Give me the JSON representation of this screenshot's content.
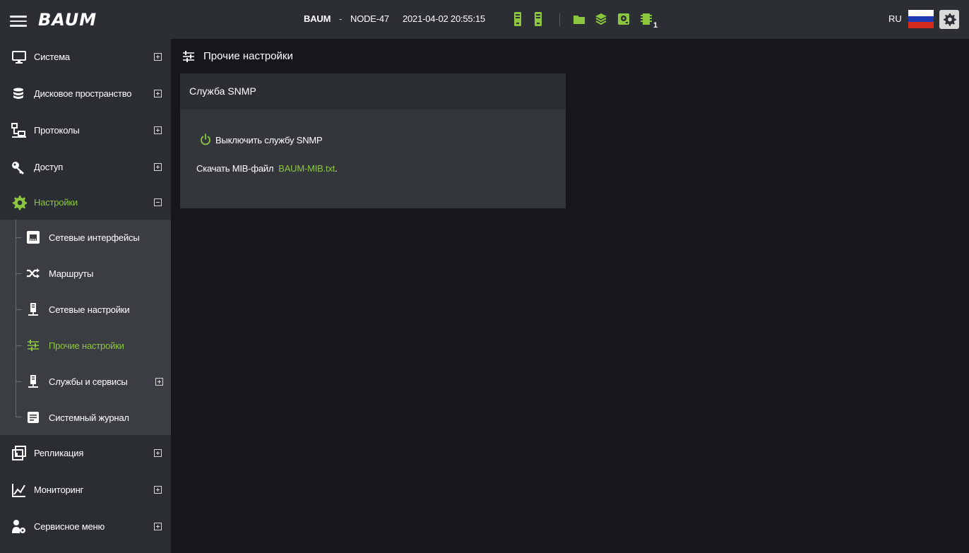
{
  "header": {
    "logo": "BAUM",
    "brand": "BAUM",
    "separator": "-",
    "node": "NODE-47",
    "datetime": "2021-04-02 20:55:15",
    "status_badge": "1",
    "language": "RU",
    "accent_color": "#8cc63f"
  },
  "sidebar": {
    "items": [
      {
        "label": "Система",
        "icon": "monitor-icon"
      },
      {
        "label": "Дисковое пространство",
        "icon": "database-icon"
      },
      {
        "label": "Протоколы",
        "icon": "network-icon"
      },
      {
        "label": "Доступ",
        "icon": "key-icon"
      },
      {
        "label": "Настройки",
        "icon": "gear-icon"
      },
      {
        "label": "Репликация",
        "icon": "replication-icon"
      },
      {
        "label": "Мониторинг",
        "icon": "chart-icon"
      },
      {
        "label": "Сервисное меню",
        "icon": "service-user-icon"
      }
    ],
    "settings_children": [
      {
        "label": "Сетевые интерфейсы",
        "icon": "ethernet-port-icon"
      },
      {
        "label": "Маршруты",
        "icon": "shuffle-icon"
      },
      {
        "label": "Сетевые настройки",
        "icon": "server-icon"
      },
      {
        "label": "Прочие настройки",
        "icon": "sliders-icon"
      },
      {
        "label": "Службы и сервисы",
        "icon": "server-icon"
      },
      {
        "label": "Системный журнал",
        "icon": "document-icon"
      }
    ]
  },
  "main": {
    "title": "Прочие настройки",
    "card": {
      "title": "Служба SNMP",
      "toggle_label": "Выключить службу SNMP",
      "mib_prefix": "Скачать MIB-файл",
      "mib_link": "BAUM-MIB.txt",
      "mib_suffix": "."
    }
  }
}
